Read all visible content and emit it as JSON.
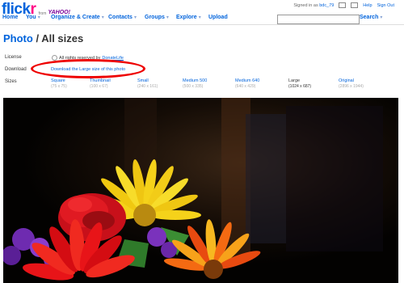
{
  "brand": {
    "logo_f1": "flick",
    "logo_f2": "r",
    "from": "from",
    "yahoo": "YAHOO!"
  },
  "util": {
    "signed_in": "Signed in as",
    "user": "bdc_79",
    "help": "Help",
    "signout": "Sign Out"
  },
  "nav": [
    {
      "label": "Home",
      "caret": ""
    },
    {
      "label": "You",
      "caret": "▾"
    },
    {
      "label": "Organize & Create",
      "caret": "▾"
    },
    {
      "label": "Contacts",
      "caret": "▾"
    },
    {
      "label": "Groups",
      "caret": "▾"
    },
    {
      "label": "Explore",
      "caret": "▾"
    },
    {
      "label": "Upload",
      "caret": ""
    }
  ],
  "search": {
    "label": "Search",
    "caret": "▾",
    "value": ""
  },
  "page": {
    "crumb": "Photo",
    "sep": " / ",
    "title": "All sizes"
  },
  "license": {
    "label": "License",
    "text": "All rights reserved by",
    "owner": "DonateLife"
  },
  "download": {
    "label": "Download",
    "link": "Download the Large size of this photo"
  },
  "sizes": {
    "label": "Sizes",
    "items": [
      {
        "name": "Square",
        "dims": "(75 x 75)"
      },
      {
        "name": "Thumbnail",
        "dims": "(100 x 67)"
      },
      {
        "name": "Small",
        "dims": "(240 x 161)"
      },
      {
        "name": "Medium 500",
        "dims": "(500 x 335)"
      },
      {
        "name": "Medium 640",
        "dims": "(640 x 429)"
      },
      {
        "name": "Large",
        "dims": "(1024 x 687)",
        "selected": true
      },
      {
        "name": "Original",
        "dims": "(2896 x 1944)"
      }
    ]
  }
}
